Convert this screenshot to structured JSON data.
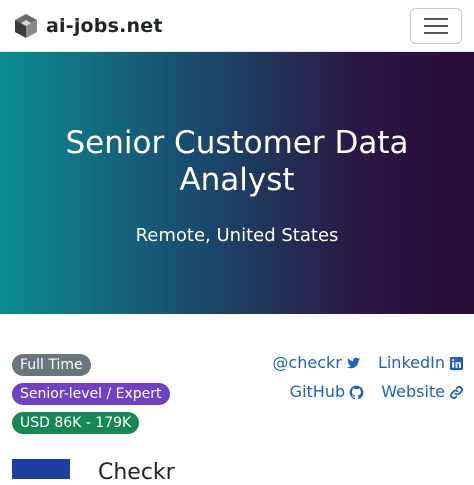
{
  "site": {
    "brand": "ai-jobs.net",
    "logo_icon": "cube-logo-icon",
    "menu_icon": "hamburger-icon"
  },
  "hero": {
    "title": "Senior Customer Data Analyst",
    "location": "Remote, United States"
  },
  "badges": [
    {
      "label": "Full Time",
      "color": "#6c757d"
    },
    {
      "label": "Senior-level / Expert",
      "color": "#6f42c1"
    },
    {
      "label": "USD 86K - 179K",
      "color": "#198754"
    }
  ],
  "social": {
    "twitter": {
      "label": "@checkr",
      "icon": "twitter-icon"
    },
    "linkedin": {
      "label": "LinkedIn",
      "icon": "linkedin-icon"
    },
    "github": {
      "label": "GitHub",
      "icon": "github-icon"
    },
    "website": {
      "label": "Website",
      "icon": "link-icon"
    }
  },
  "company": {
    "name": "Checkr"
  },
  "colors": {
    "link": "#1f63b0",
    "hero_start": "#0b8b92",
    "hero_end": "#260c35"
  }
}
